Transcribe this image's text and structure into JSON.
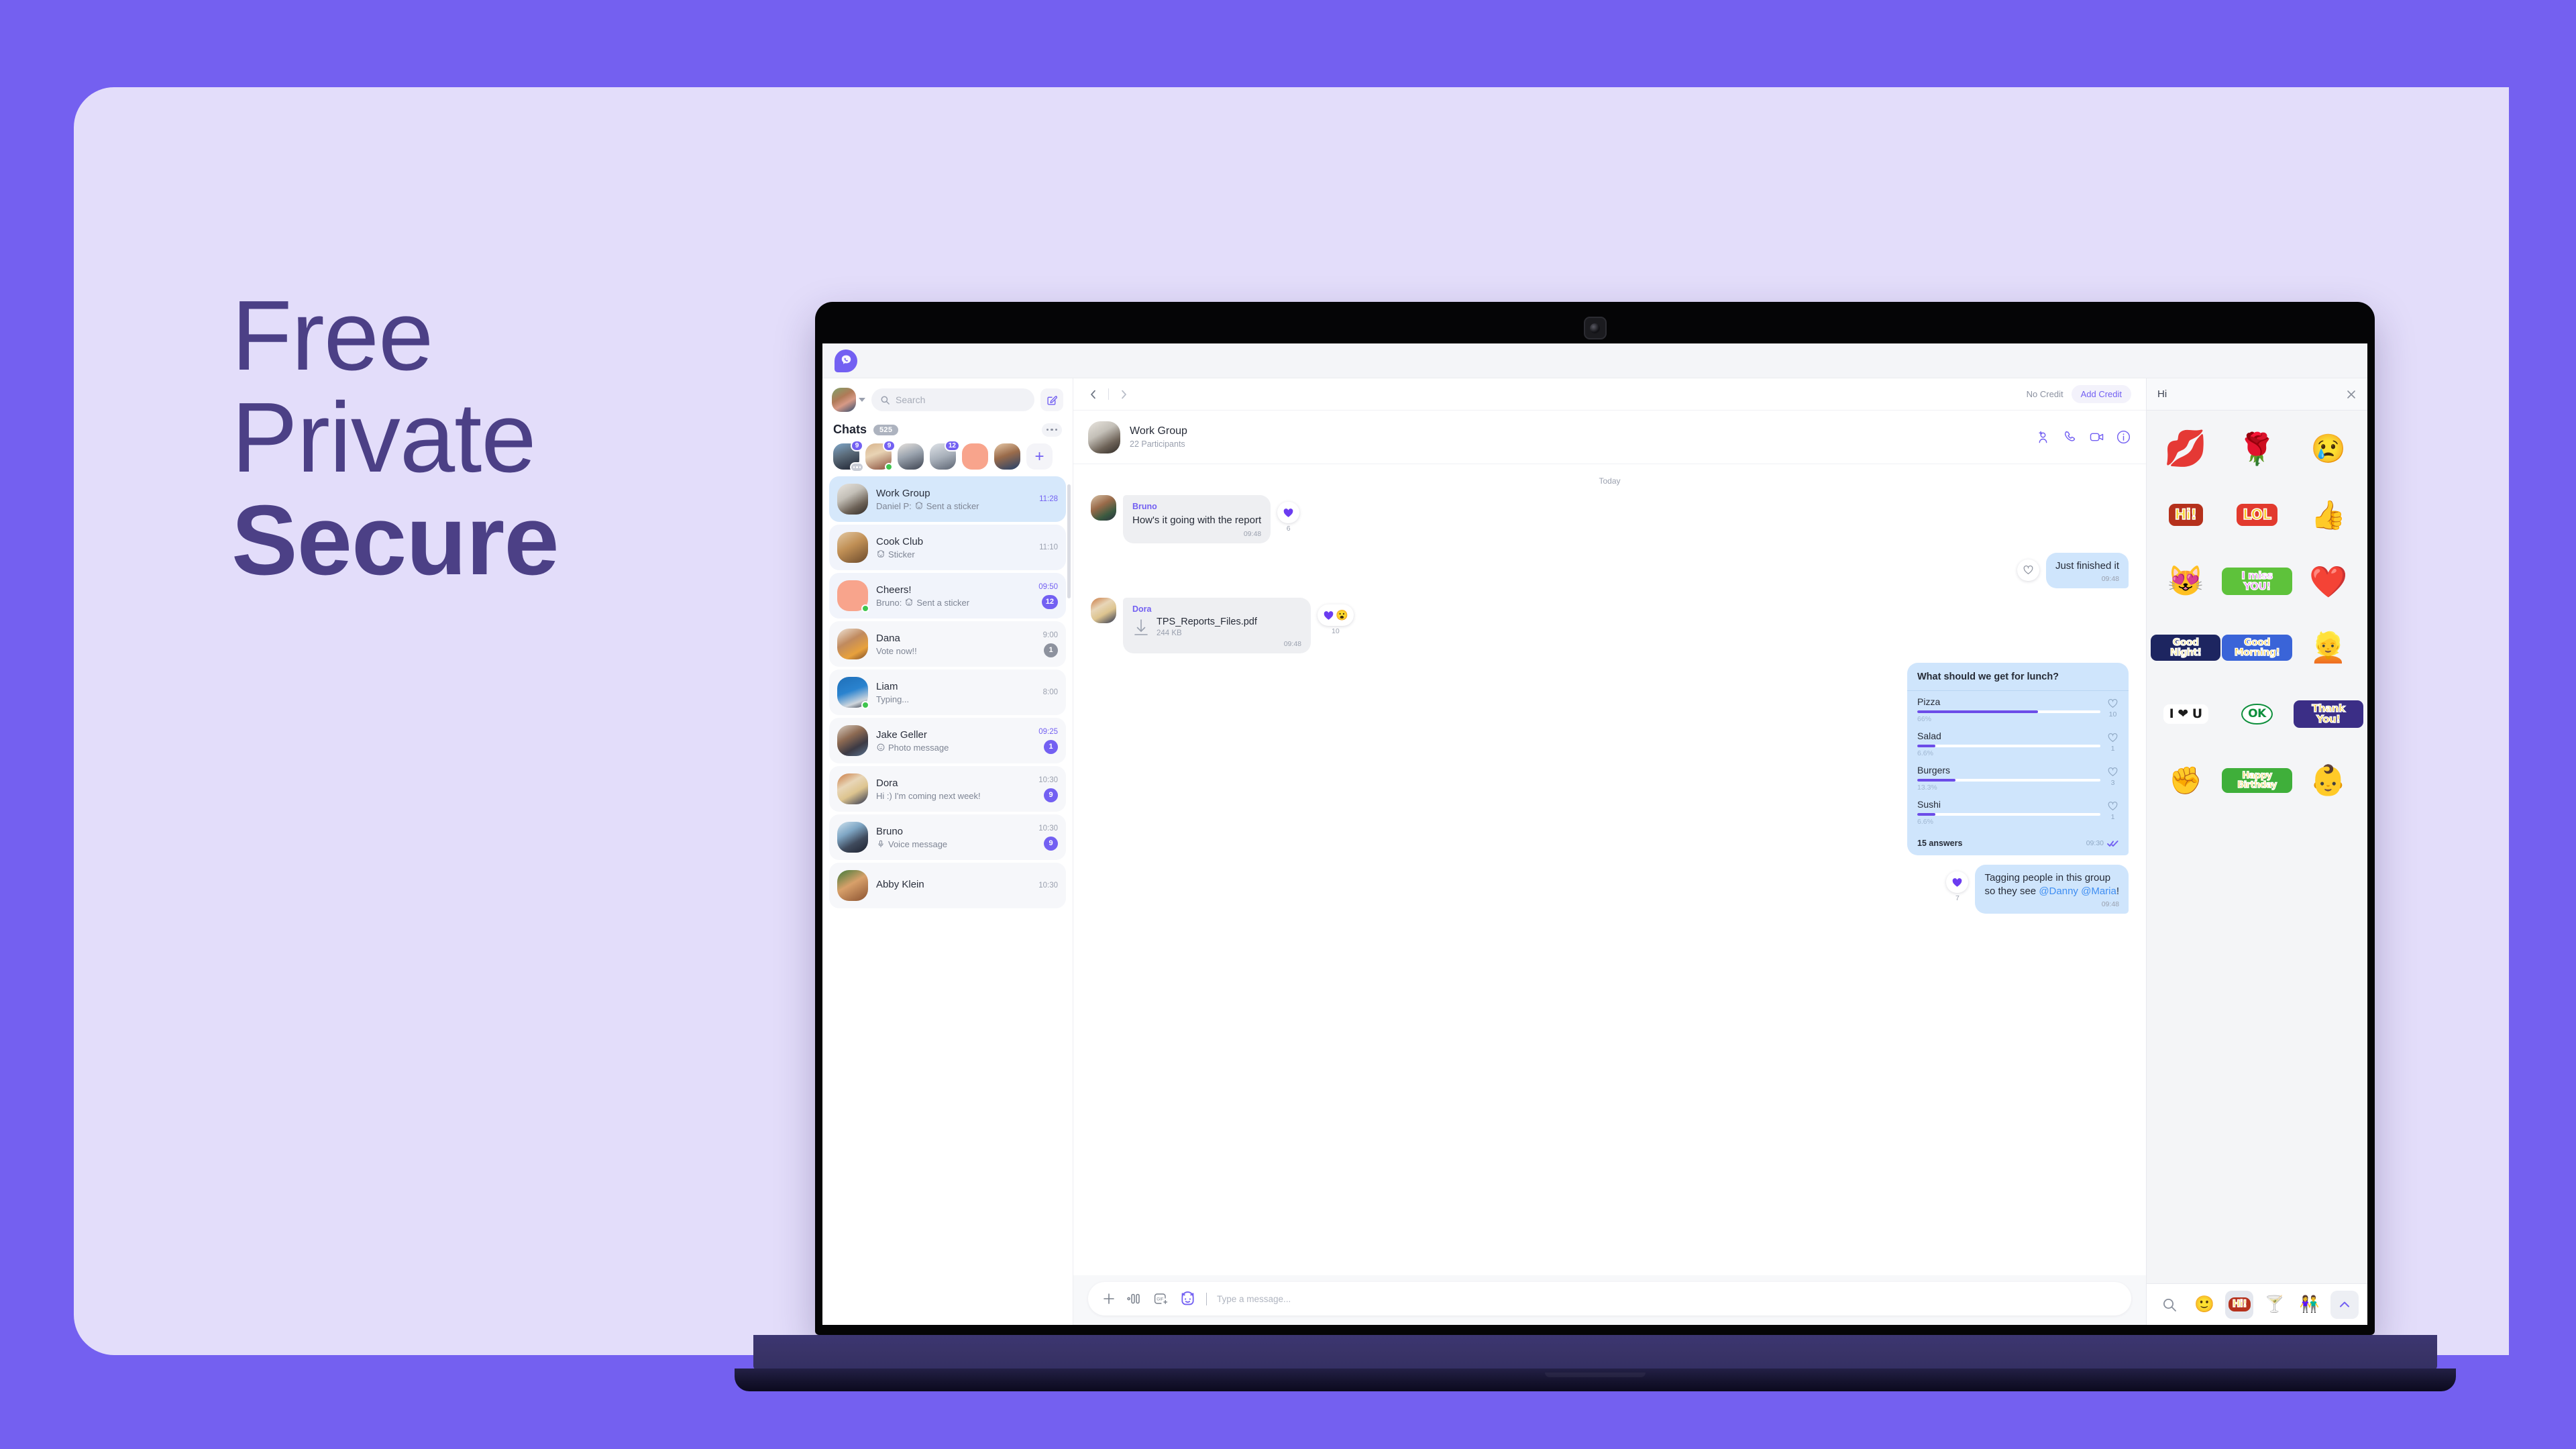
{
  "marketing": {
    "line1": "Free",
    "line2": "Private",
    "line3": "Secure",
    "text_color": "#4C4086",
    "bg_color": "#7460F0",
    "card_color": "#E3DDFA"
  },
  "app": {
    "brand": "viber-logo",
    "accent_color": "#7360F2"
  },
  "sidebar": {
    "search": {
      "placeholder": "Search",
      "icon": "search-icon"
    },
    "compose_icon": "compose-icon",
    "chats_title": "Chats",
    "chats_count": "525",
    "stories": [
      {
        "badge": "9",
        "typing": true,
        "online": false
      },
      {
        "badge": "9",
        "typing": false,
        "online": true
      },
      {
        "badge": "",
        "typing": false,
        "online": false
      },
      {
        "badge": "12",
        "typing": false,
        "online": false
      },
      {
        "badge": "",
        "typing": false,
        "online": false
      },
      {
        "badge": "",
        "typing": false,
        "online": false
      }
    ],
    "add_story_label": "+",
    "chats": [
      {
        "name": "Work Group",
        "time": "11:28",
        "selected": true,
        "preview_who": "Daniel P:",
        "preview": "Sent a sticker",
        "preview_icon": "sticker-icon",
        "badge": "",
        "badge_color": "",
        "time_unread": true,
        "online": false
      },
      {
        "name": "Cook Club",
        "time": "11:10",
        "selected": false,
        "preview_who": "",
        "preview": "Sticker",
        "preview_icon": "sticker-icon",
        "badge": "",
        "badge_color": "",
        "time_unread": false,
        "online": false
      },
      {
        "name": "Cheers!",
        "time": "09:50",
        "selected": false,
        "preview_who": "Bruno:",
        "preview": "Sent a sticker",
        "preview_icon": "sticker-icon",
        "badge": "12",
        "badge_color": "purple",
        "time_unread": true,
        "online": true
      },
      {
        "name": "Dana",
        "time": "9:00",
        "selected": false,
        "preview_who": "",
        "preview": "Vote now!!",
        "preview_icon": "",
        "badge": "1",
        "badge_color": "gray",
        "time_unread": false,
        "online": false
      },
      {
        "name": "Liam",
        "time": "8:00",
        "selected": false,
        "preview_who": "",
        "preview": "Typing...",
        "preview_icon": "",
        "badge": "",
        "badge_color": "",
        "time_unread": false,
        "online": true
      },
      {
        "name": "Jake Geller",
        "time": "09:25",
        "selected": false,
        "preview_who": "",
        "preview": "Photo message",
        "preview_icon": "photo-icon",
        "badge": "1",
        "badge_color": "purple",
        "time_unread": true,
        "online": false
      },
      {
        "name": "Dora",
        "time": "10:30",
        "selected": false,
        "preview_who": "",
        "preview": "Hi :) I'm coming next week!",
        "preview_icon": "",
        "badge": "9",
        "badge_color": "purple",
        "time_unread": false,
        "online": false
      },
      {
        "name": "Bruno",
        "time": "10:30",
        "selected": false,
        "preview_who": "",
        "preview": "Voice message",
        "preview_icon": "mic-icon",
        "badge": "9",
        "badge_color": "purple",
        "time_unread": false,
        "online": false
      },
      {
        "name": "Abby Klein",
        "time": "10:30",
        "selected": false,
        "preview_who": "",
        "preview": "",
        "preview_icon": "",
        "badge": "",
        "badge_color": "",
        "time_unread": false,
        "online": false
      }
    ]
  },
  "topbar": {
    "back_icon": "chevron-left-icon",
    "forward_icon": "chevron-right-icon",
    "no_credit": "No Credit",
    "add_credit": "Add Credit"
  },
  "conversation": {
    "title": "Work Group",
    "subtitle": "22 Participants",
    "actions": [
      "add-participant-icon",
      "audio-call-icon",
      "video-call-icon",
      "info-icon"
    ],
    "day_separator": "Today",
    "messages": [
      {
        "kind": "text",
        "direction": "in",
        "sender": "Bruno",
        "text": "How's it going with the report",
        "time": "09:48",
        "reaction": {
          "emoji": "heart-filled",
          "count": "6"
        }
      },
      {
        "kind": "text",
        "direction": "out",
        "sender": "",
        "text": "Just finished it",
        "time": "09:48",
        "reaction": {
          "emoji": "heart-outline",
          "count": ""
        }
      },
      {
        "kind": "file",
        "direction": "in",
        "sender": "Dora",
        "file_name": "TPS_Reports_Files.pdf",
        "file_size": "244 KB",
        "time": "09:48",
        "reaction": {
          "emoji": "heart-filled+shocked",
          "count": "10"
        }
      },
      {
        "kind": "poll",
        "direction": "out",
        "time": "09:30"
      },
      {
        "kind": "text",
        "direction": "out",
        "sender": "",
        "text_pre": "Tagging people in this group",
        "text_mid": "so they see ",
        "mention1": "@Danny",
        "mention2": "@Maria",
        "text_post": "!",
        "time": "09:48",
        "reaction": {
          "emoji": "heart-filled",
          "count": "7"
        }
      }
    ],
    "composer": {
      "plus_icon": "plus-icon",
      "voice_icon": "voice-waveform-icon",
      "gif_icon": "gif-add-icon",
      "sticker_icon": "sticker-icon",
      "placeholder": "Type a message..."
    }
  },
  "chart_data": {
    "type": "bar",
    "title": "What should we get for lunch?",
    "categories": [
      "Pizza",
      "Salad",
      "Burgers",
      "Sushi"
    ],
    "values": [
      66,
      6.6,
      13.3,
      6.6
    ],
    "value_labels": [
      "66%",
      "6.6%",
      "13.3%",
      "6.6%"
    ],
    "votes": [
      "10",
      "1",
      "3",
      "1"
    ],
    "total_label": "15 answers",
    "timestamp": "09:30",
    "xlabel": "",
    "ylabel": "",
    "ylim": [
      0,
      100
    ],
    "bar_color": "#6C4CE8",
    "track_color": "#FFFFFF",
    "legend": "none",
    "grid": false
  },
  "sticker_panel": {
    "title": "Hi",
    "close_icon": "close-icon",
    "stickers": [
      {
        "name": "kiss-lips-sticker",
        "glyph": "💋",
        "kind": "emoji"
      },
      {
        "name": "rose-sticker",
        "glyph": "🌹",
        "kind": "emoji"
      },
      {
        "name": "sad-boy-sticker",
        "glyph": "😢",
        "kind": "emoji"
      },
      {
        "name": "lol-sticker",
        "glyph": "LOL",
        "kind": "word",
        "color": "#F7C520",
        "bg": "#E23A2E"
      },
      {
        "name": "hi-sticker",
        "glyph": "Hi!",
        "kind": "word",
        "color": "#F8D22B",
        "bg": "#B5311C"
      },
      {
        "name": "thumbs-up-sticker",
        "glyph": "👍",
        "kind": "emoji"
      },
      {
        "name": "hugging-cats-sticker",
        "glyph": "🐱",
        "kind": "emoji"
      },
      {
        "name": "i-miss-you-sticker",
        "glyph": "I miss YOU!",
        "kind": "word",
        "color": "#D85BE8",
        "bg": "#5EC23B"
      },
      {
        "name": "hearts-sticker",
        "glyph": "❤️",
        "kind": "emoji"
      },
      {
        "name": "good-night-sticker",
        "glyph": "Good Night!",
        "kind": "word",
        "color": "#F6E27A",
        "bg": "#1D2560"
      },
      {
        "name": "good-morning-sticker",
        "glyph": "Good Morning!",
        "kind": "word",
        "color": "#F8C51C",
        "bg": "#3A64D8"
      },
      {
        "name": "purple-hair-girl-sticker",
        "glyph": "👧",
        "kind": "emoji"
      },
      {
        "name": "i-love-u-sticker",
        "glyph": "I ❤ U",
        "kind": "word",
        "color": "#1B1B1B",
        "bg": "#FFFFFF"
      },
      {
        "name": "ok-sticker",
        "glyph": "OK",
        "kind": "word",
        "color": "#0E8F3C",
        "bg": "#FFFFFF"
      },
      {
        "name": "fist-bump-sticker",
        "glyph": "✊",
        "kind": "emoji"
      },
      {
        "name": "thank-you-sticker",
        "glyph": "Thank You!",
        "kind": "word",
        "color": "#F8C51C",
        "bg": "#3B2E86"
      },
      {
        "name": "happy-birthday-sticker",
        "glyph": "Happy Birthday",
        "kind": "word",
        "color": "#F8C51C",
        "bg": "#3FAF3A"
      },
      {
        "name": "baby-sticker",
        "glyph": "👶",
        "kind": "emoji"
      }
    ],
    "tabs": [
      {
        "name": "sticker-search-tab",
        "glyph": "search",
        "active": false
      },
      {
        "name": "emoji-tab",
        "glyph": "🙂",
        "active": false
      },
      {
        "name": "hi-pack-tab",
        "glyph": "Hi!",
        "active": true
      },
      {
        "name": "drinks-pack-tab",
        "glyph": "🍹",
        "active": false
      },
      {
        "name": "couple-pack-tab",
        "glyph": "💑",
        "active": false
      },
      {
        "name": "collapse-tab",
        "glyph": "chevron-up",
        "active": false
      }
    ]
  }
}
